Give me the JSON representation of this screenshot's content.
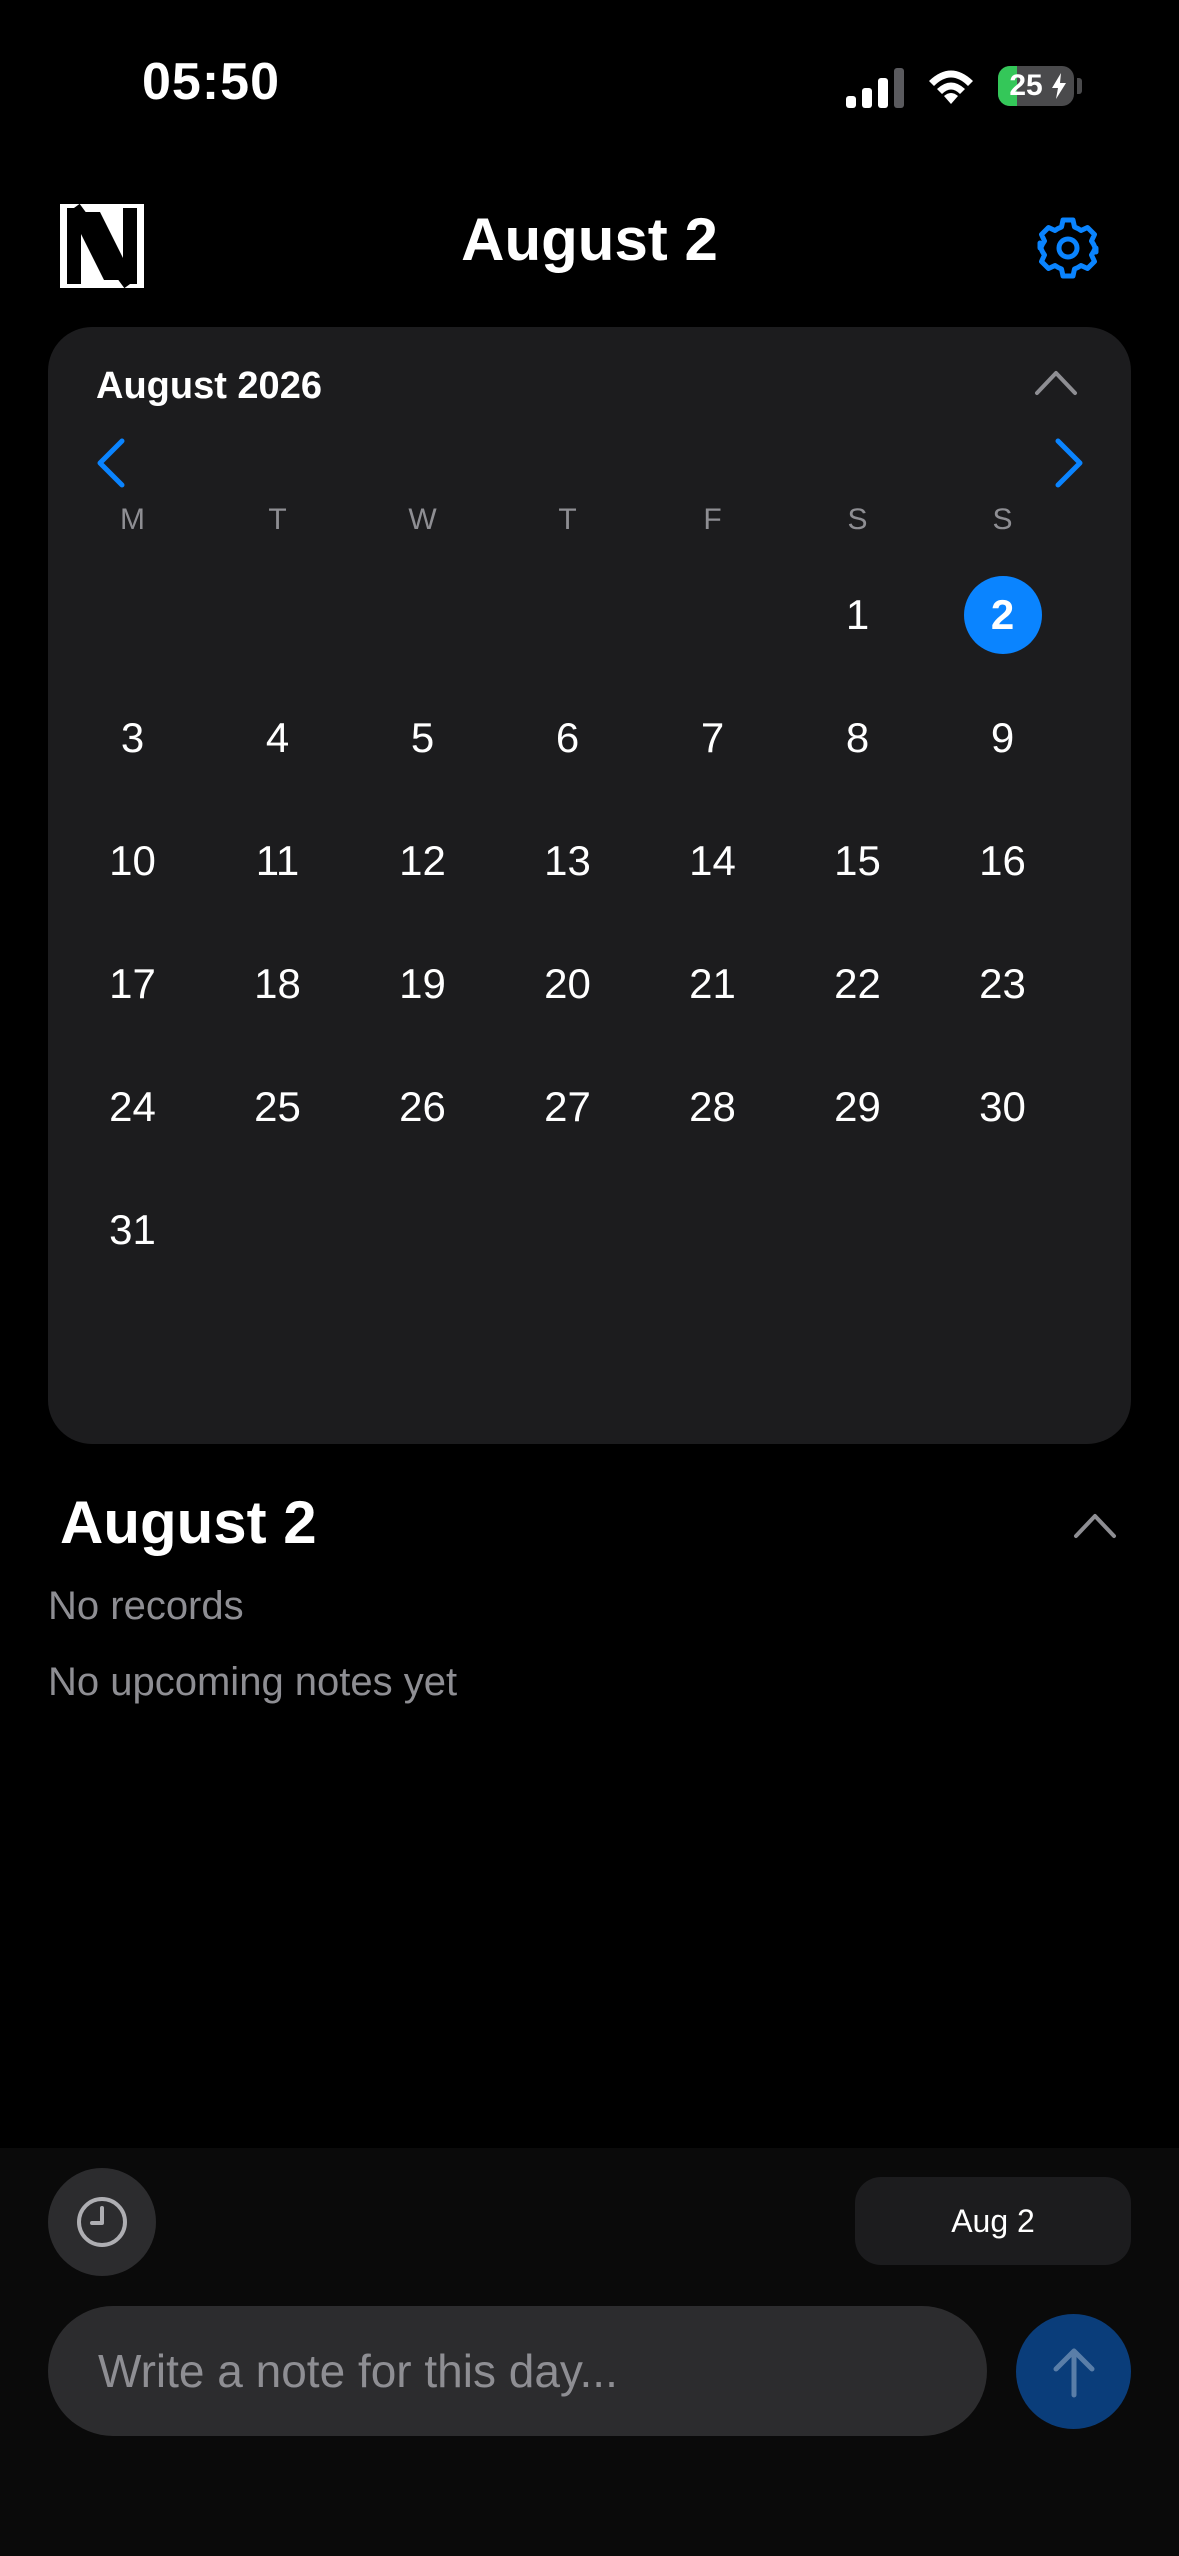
{
  "status_bar": {
    "time": "05:50",
    "battery_level": "25",
    "battery_fraction": 0.25
  },
  "header": {
    "title": "August 2",
    "logo_icon": "n-logo-icon",
    "settings_icon": "gear-icon"
  },
  "calendar": {
    "month_label": "August 2026",
    "weekdays": [
      "M",
      "T",
      "W",
      "T",
      "F",
      "S",
      "S"
    ],
    "leading_blanks": 5,
    "days": [
      "1",
      "2",
      "3",
      "4",
      "5",
      "6",
      "7",
      "8",
      "9",
      "10",
      "11",
      "12",
      "13",
      "14",
      "15",
      "16",
      "17",
      "18",
      "19",
      "20",
      "21",
      "22",
      "23",
      "24",
      "25",
      "26",
      "27",
      "28",
      "29",
      "30",
      "31"
    ],
    "selected_day": "2"
  },
  "day_section": {
    "title": "August 2",
    "no_records": "No records",
    "no_upcoming": "No upcoming notes yet"
  },
  "composer": {
    "date_pill": "Aug 2",
    "placeholder": "Write a note for this day..."
  },
  "colors": {
    "accent": "#0a84ff",
    "card": "#1c1c1e",
    "muted": "#8e8e93",
    "battery_green": "#34c759"
  }
}
